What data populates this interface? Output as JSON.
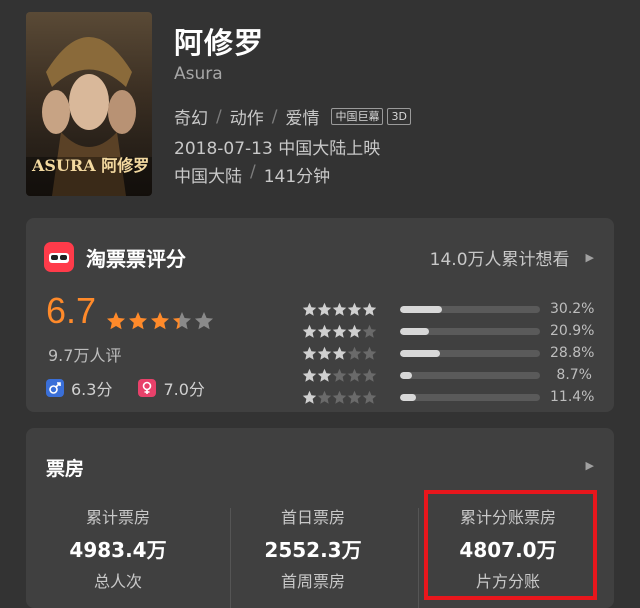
{
  "movie": {
    "title": "阿修罗",
    "subtitle": "Asura",
    "genres": [
      "奇幻",
      "动作",
      "爱情"
    ],
    "tags": [
      "中国巨幕",
      "3D"
    ],
    "release": "2018-07-13 中国大陆上映",
    "region": "中国大陆",
    "duration": "141分钟",
    "poster_text": "ASURA 阿修罗"
  },
  "rating": {
    "source": "淘票票评分",
    "want": "14.0万人累计想看",
    "score": "6.7",
    "star_value": 3.35,
    "count": "9.7万人评",
    "male": "6.3分",
    "female": "7.0分",
    "distribution": [
      {
        "stars": 5,
        "pct": "30.2%",
        "value": 30.2
      },
      {
        "stars": 4,
        "pct": "20.9%",
        "value": 20.9
      },
      {
        "stars": 3,
        "pct": "28.8%",
        "value": 28.8
      },
      {
        "stars": 2,
        "pct": "8.7%",
        "value": 8.7
      },
      {
        "stars": 1,
        "pct": "11.4%",
        "value": 11.4
      }
    ]
  },
  "box_office": {
    "title": "票房",
    "stats": [
      {
        "label": "累计票房",
        "value": "4983.4万"
      },
      {
        "label": "首日票房",
        "value": "2552.3万"
      },
      {
        "label": "累计分账票房",
        "value": "4807.0万"
      },
      {
        "label": "总人次",
        "value": ""
      },
      {
        "label": "首周票房",
        "value": ""
      },
      {
        "label": "片方分账",
        "value": ""
      }
    ]
  },
  "colors": {
    "accent": "#ff8a2a",
    "highlight": "#e8161c",
    "logo": "#ff3b4a"
  }
}
